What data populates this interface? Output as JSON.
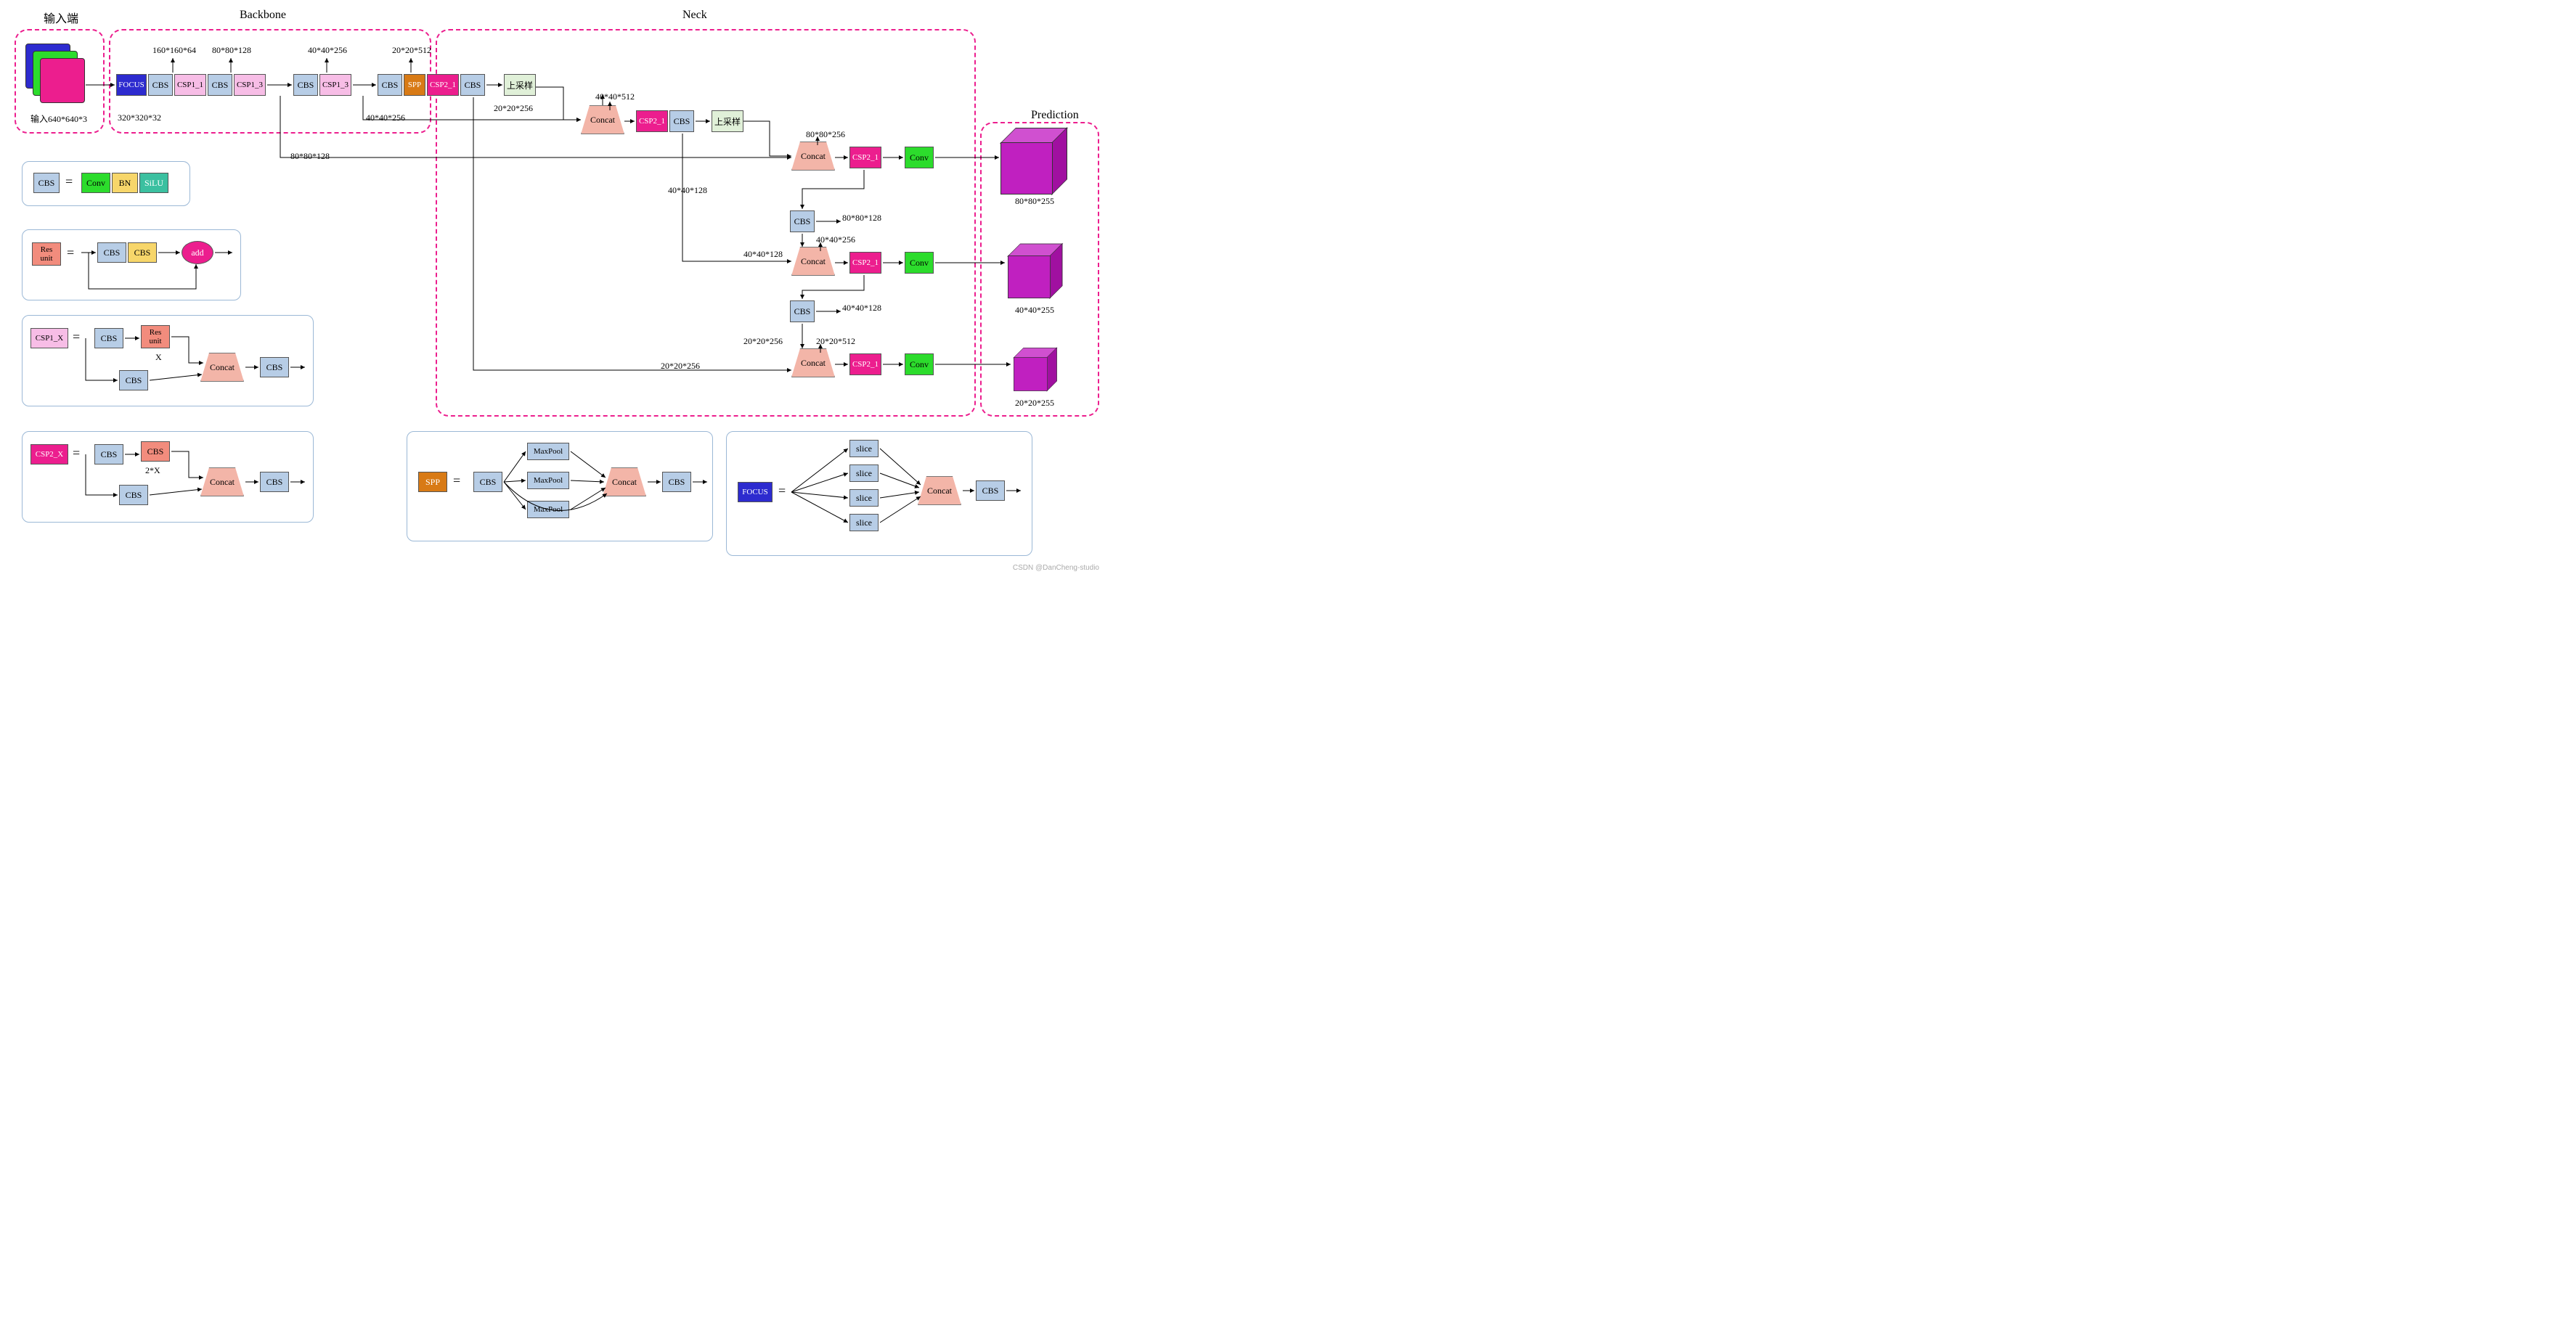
{
  "sections": {
    "input": "输入端",
    "backbone": "Backbone",
    "neck": "Neck",
    "pred": "Prediction"
  },
  "input": {
    "label": "输入640*640*3"
  },
  "backbone": {
    "focus": "FOCUS",
    "cbs": "CBS",
    "csp1_1": "CSP1_1",
    "csp1_3": "CSP1_3",
    "spp": "SPP",
    "csp2_1": "CSP2_1",
    "d320": "320*320*32",
    "d160": "160*160*64",
    "d80": "80*80*128",
    "d40": "40*40*256",
    "d20": "20*20*512",
    "d40b": "40*40*256",
    "d80b": "80*80*128"
  },
  "neck": {
    "up": "上采样",
    "concat": "Concat",
    "csp2_1": "CSP2_1",
    "cbs": "CBS",
    "conv": "Conv",
    "t20_256": "20*20*256",
    "t40_512": "40*40*512",
    "t80_256": "80*80*256",
    "t40_128": "40*40*128",
    "t80_128": "80*80*128",
    "t40_128b": "40*40*128",
    "t40_256": "40*40*256",
    "t20_256b": "20*20*256",
    "t20_512": "20*20*512"
  },
  "pred": {
    "p80": "80*80*255",
    "p40": "40*40*255",
    "p20": "20*20*255"
  },
  "legends": {
    "cbs": {
      "CBS": "CBS",
      "Conv": "Conv",
      "BN": "BN",
      "SiLU": "SiLU"
    },
    "res": {
      "Res": "Res unit",
      "CBS": "CBS",
      "add": "add"
    },
    "csp1": {
      "CSP1_X": "CSP1_X",
      "CBS": "CBS",
      "Res": "Res unit",
      "Concat": "Concat",
      "X": "X"
    },
    "csp2": {
      "CSP2_X": "CSP2_X",
      "CBS": "CBS",
      "Concat": "Concat",
      "X": "2*X"
    },
    "spp": {
      "SPP": "SPP",
      "CBS": "CBS",
      "MaxPool": "MaxPool",
      "Concat": "Concat"
    },
    "focus": {
      "FOCUS": "FOCUS",
      "slice": "slice",
      "Concat": "Concat",
      "CBS": "CBS"
    }
  },
  "watermark": "CSDN @DanCheng-studio"
}
